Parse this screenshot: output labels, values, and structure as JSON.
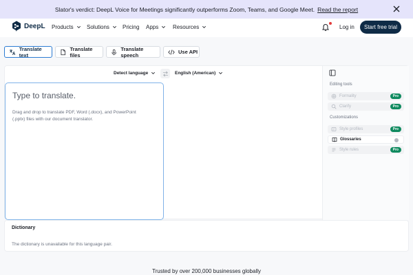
{
  "banner": {
    "text": "Slator's verdict: DeepL Voice for Meetings significantly outperforms Zoom, Teams, and Google Meet.",
    "link": "Read the report"
  },
  "header": {
    "logo": "DeepL",
    "nav": [
      "Products",
      "Solutions",
      "Pricing",
      "Apps",
      "Resources"
    ],
    "login": "Log in",
    "cta": "Start free trial"
  },
  "tabs": [
    "Translate text",
    "Translate files",
    "Translate speech",
    "Use API"
  ],
  "translator": {
    "source_lang": "Detect language",
    "target_lang": "English (American)",
    "source_title": "Type to translate.",
    "source_hint": "Drag and drop to translate PDF, Word (.docx), and PowerPoint (.pptx) files with our document translator."
  },
  "sidepanel": {
    "editing_heading": "Editing tools",
    "editing_items": [
      "Formality",
      "Clarify"
    ],
    "custom_heading": "Customizations",
    "custom_items": [
      "Style profiles",
      "Glossaries",
      "Style rules"
    ],
    "badge": "Pro"
  },
  "dictionary": {
    "title": "Dictionary",
    "text": "The dictionary is unavailable for this language pair."
  },
  "footer": {
    "trust": "Trusted by over 200,000 businesses globally"
  },
  "colors": {
    "brand_navy": "#0f2b46",
    "accent_blue": "#2b7bd3",
    "banner_bg": "#e5e4fb",
    "pro_green": "#0f8a5f"
  }
}
